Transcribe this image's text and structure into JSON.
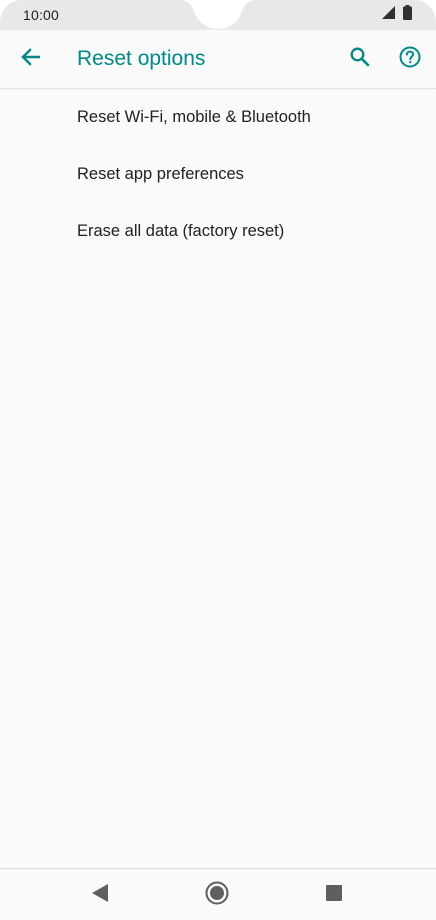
{
  "status_bar": {
    "time": "10:00",
    "icons": [
      "signal-icon",
      "battery-icon"
    ]
  },
  "app_bar": {
    "title": "Reset options",
    "back_icon": "arrow-back-icon",
    "search_icon": "search-icon",
    "help_icon": "help-icon",
    "accent_color": "#018786"
  },
  "options": [
    {
      "label": "Reset Wi-Fi, mobile & Bluetooth"
    },
    {
      "label": "Reset app preferences"
    },
    {
      "label": "Erase all data (factory reset)"
    }
  ],
  "nav_bar": {
    "icons": [
      "nav-back-icon",
      "nav-home-icon",
      "nav-recents-icon"
    ]
  }
}
